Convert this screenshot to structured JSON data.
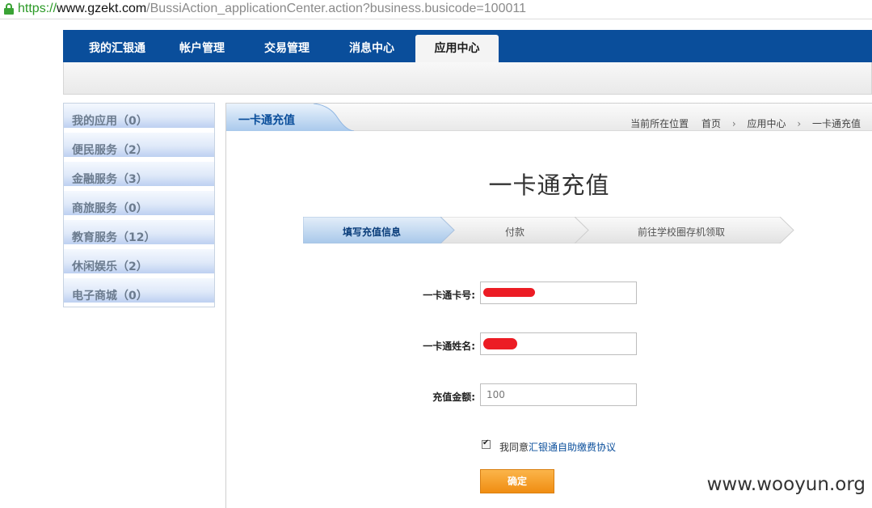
{
  "browser": {
    "url_protocol": "https://",
    "url_host": "www.gzekt.com",
    "url_path": "/BussiAction_applicationCenter.action?business.busicode=100011"
  },
  "nav": {
    "items": [
      {
        "label": "我的汇银通"
      },
      {
        "label": "帐户管理"
      },
      {
        "label": "交易管理"
      },
      {
        "label": "消息中心"
      },
      {
        "label": "应用中心"
      }
    ],
    "active_index": 4
  },
  "sidebar": {
    "items": [
      {
        "label": "我的应用（0）"
      },
      {
        "label": "便民服务（2）"
      },
      {
        "label": "金融服务（3）"
      },
      {
        "label": "商旅服务（0）"
      },
      {
        "label": "教育服务（12）"
      },
      {
        "label": "休闲娱乐（2）"
      },
      {
        "label": "电子商城（0）"
      }
    ]
  },
  "panel": {
    "tab_title": "一卡通充值",
    "breadcrumb": {
      "prefix": "当前所在位置",
      "items": [
        "首页",
        "应用中心",
        "一卡通充值"
      ]
    },
    "page_title": "一卡通充值"
  },
  "steps": {
    "items": [
      {
        "label": "填写充值信息"
      },
      {
        "label": "付款"
      },
      {
        "label": "前往学校圈存机领取"
      }
    ],
    "active_index": 0
  },
  "form": {
    "card_number_label": "一卡通卡号:",
    "card_name_label": "一卡通姓名:",
    "amount_label": "充值金额:",
    "amount_value": "100",
    "agree_checked": true,
    "agree_prefix": "我同意",
    "agree_link": "汇银通自助缴费协议",
    "confirm_label": "确定"
  },
  "watermark": "www.wooyun.org",
  "colors": {
    "nav_bg": "#0a4e9b",
    "confirm_button": "#f5a023",
    "redaction": "#ec1c24"
  }
}
